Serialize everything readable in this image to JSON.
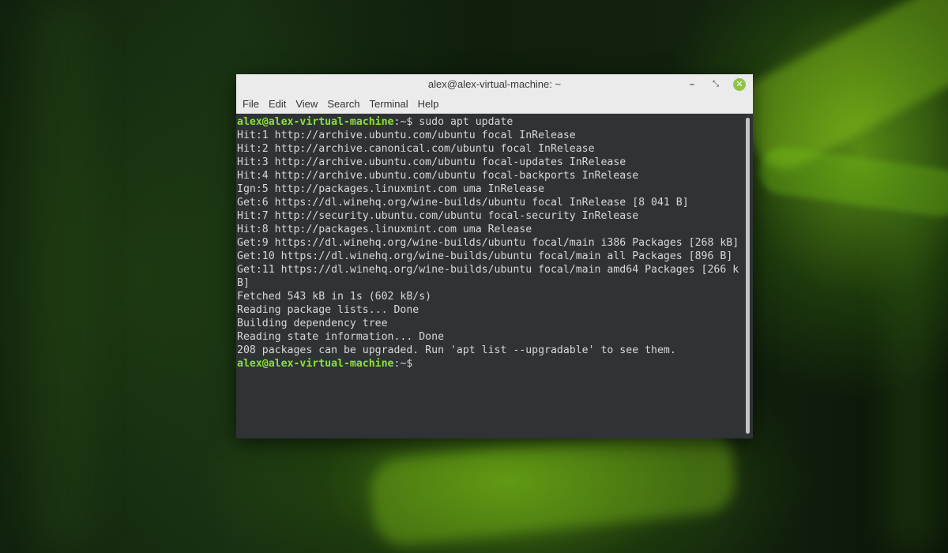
{
  "window": {
    "title": "alex@alex-virtual-machine: ~",
    "minimize_glyph": "–",
    "maximize_glyph": "⤡",
    "close_glyph": "✕"
  },
  "menubar": {
    "items": [
      "File",
      "Edit",
      "View",
      "Search",
      "Terminal",
      "Help"
    ]
  },
  "terminal": {
    "prompt_user": "alex@alex-virtual-machine",
    "prompt_path": ":~$",
    "command": " sudo apt update",
    "output": [
      "Hit:1 http://archive.ubuntu.com/ubuntu focal InRelease",
      "Hit:2 http://archive.canonical.com/ubuntu focal InRelease",
      "Hit:3 http://archive.ubuntu.com/ubuntu focal-updates InRelease",
      "Hit:4 http://archive.ubuntu.com/ubuntu focal-backports InRelease",
      "Ign:5 http://packages.linuxmint.com uma InRelease",
      "Get:6 https://dl.winehq.org/wine-builds/ubuntu focal InRelease [8 041 B]",
      "Hit:7 http://security.ubuntu.com/ubuntu focal-security InRelease",
      "Hit:8 http://packages.linuxmint.com uma Release",
      "Get:9 https://dl.winehq.org/wine-builds/ubuntu focal/main i386 Packages [268 kB]",
      "Get:10 https://dl.winehq.org/wine-builds/ubuntu focal/main all Packages [896 B]",
      "Get:11 https://dl.winehq.org/wine-builds/ubuntu focal/main amd64 Packages [266 k",
      "B]",
      "Fetched 543 kB in 1s (602 kB/s)",
      "Reading package lists... Done",
      "Building dependency tree",
      "Reading state information... Done",
      "208 packages can be upgraded. Run 'apt list --upgradable' to see them."
    ],
    "final_prompt_path": ":~$"
  },
  "colors": {
    "terminal_bg": "#2f3335",
    "terminal_fg": "#d7d7d7",
    "prompt_green": "#8ae234",
    "close_button": "#8fc444",
    "titlebar_bg": "#ebebeb"
  }
}
